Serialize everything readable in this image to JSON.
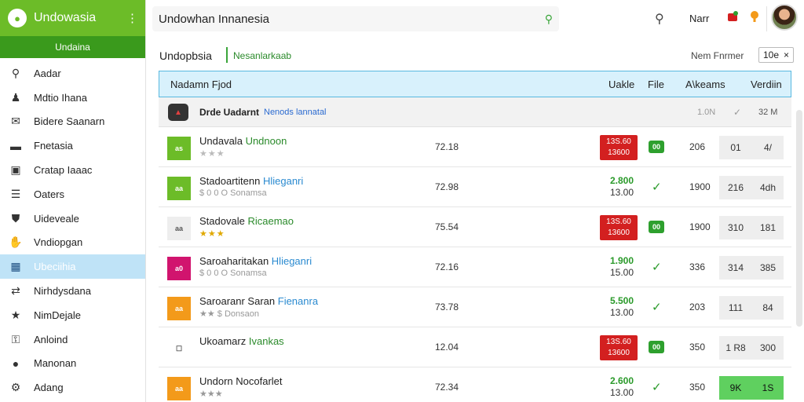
{
  "sidebar": {
    "brand_name": "Undowasia",
    "sub_brand": "Undaina",
    "items": [
      {
        "label": "Aadar",
        "icon": "search-icon"
      },
      {
        "label": "Mdtio Ihana",
        "icon": "person-icon"
      },
      {
        "label": "Bidere Saanarn",
        "icon": "inbox-icon"
      },
      {
        "label": "Fnetasia",
        "icon": "card-icon"
      },
      {
        "label": "Cratap Iaaac",
        "icon": "window-icon"
      },
      {
        "label": "Oaters",
        "icon": "list-icon"
      },
      {
        "label": "Uideveale",
        "icon": "shield-icon"
      },
      {
        "label": "Vndiopgan",
        "icon": "hand-icon"
      },
      {
        "label": "Ubeciihia",
        "icon": "grid-icon",
        "active": true
      },
      {
        "label": "Nirhdysdana",
        "icon": "arrows-icon"
      },
      {
        "label": "NimDejale",
        "icon": "star-icon"
      },
      {
        "label": "Anloind",
        "icon": "lock-icon"
      },
      {
        "label": "Manonan",
        "icon": "circle-icon"
      },
      {
        "label": "Adang",
        "icon": "gear-icon"
      }
    ]
  },
  "topbar": {
    "search_value": "Undowhan Innanesia",
    "user_name": "Narr"
  },
  "content": {
    "title": "Undopbsia",
    "subtitle": "Nesanlarkaab",
    "filter_label": "Nem Fnrmer",
    "close_label": "10e",
    "close_icon": "×"
  },
  "table": {
    "headers": {
      "name": "Nadamn Fjod",
      "uakle": "Uakle",
      "file": "File",
      "atkeams": "A\\keams",
      "verdiin": "Verdiin"
    },
    "subheader": {
      "name": "Drde Uadarnt",
      "tag": "Nenods lannatal",
      "v1": "1.0N",
      "v2": "✓",
      "v3": "32 M"
    },
    "rows": [
      {
        "thumb": "as",
        "thumb_color": "#6cbc28",
        "name": "Undavala",
        "tag": "Undnoon",
        "tag_type": "green",
        "sub": "",
        "stars": "★★★",
        "stars_gold": false,
        "num": "72.18",
        "status": "badge",
        "badge": [
          "13S.60",
          "13600"
        ],
        "indicator": "pill",
        "vol": "206",
        "c1": "01",
        "c2": "4/"
      },
      {
        "thumb": "aa",
        "thumb_color": "#6cbc28",
        "name": "Stadoartitenn",
        "tag": "Hlieganri",
        "tag_type": "blue",
        "sub": "$ 0 0 O Sonamsa",
        "stars": "",
        "stars_gold": false,
        "num": "72.98",
        "status": "price",
        "price": [
          "2.800",
          "13.00"
        ],
        "indicator": "check",
        "vol": "1900",
        "c1": "216",
        "c2": "4dh"
      },
      {
        "thumb": "aa",
        "thumb_color": "#eeeeee",
        "name": "Stadovale",
        "tag": "Ricaemao",
        "tag_type": "green",
        "sub": "",
        "stars": "★★★",
        "stars_gold": true,
        "num": "75.54",
        "status": "badge",
        "badge": [
          "13S.60",
          "13600"
        ],
        "indicator": "pill",
        "vol": "1900",
        "c1": "310",
        "c2": "181"
      },
      {
        "thumb": "a0",
        "thumb_color": "#d1146e",
        "name": "Saroaharitakan",
        "tag": "Hlieganri",
        "tag_type": "blue",
        "sub": "$ 0 0 O Sonamsa",
        "stars": "",
        "stars_gold": false,
        "num": "72.16",
        "status": "price",
        "price": [
          "1.900",
          "15.00"
        ],
        "indicator": "check",
        "vol": "336",
        "c1": "314",
        "c2": "385"
      },
      {
        "thumb": "aa",
        "thumb_color": "#f39a1a",
        "name": "Saroaranr Saran",
        "tag": "Fienanra",
        "tag_type": "blue",
        "sub": "★★ $ Donsaon",
        "stars": "",
        "stars_gold": false,
        "num": "73.78",
        "status": "price",
        "price": [
          "5.500",
          "13.00"
        ],
        "indicator": "check",
        "vol": "203",
        "c1": "111",
        "c2": "84"
      },
      {
        "thumb": "☐",
        "thumb_color": "#ffffff",
        "name": "Ukoamarz",
        "tag": "Ivankas",
        "tag_type": "green",
        "sub": "",
        "stars": "",
        "stars_gold": false,
        "num": "12.04",
        "status": "badge",
        "badge": [
          "13S.60",
          "13600"
        ],
        "indicator": "pill",
        "vol": "350",
        "c1": "1 R8",
        "c2": "300"
      },
      {
        "thumb": "aa",
        "thumb_color": "#f39a1a",
        "name": "Undorn Nocofarlet",
        "tag": "",
        "tag_type": "blue",
        "sub": "★★★",
        "stars": "",
        "stars_gold": false,
        "num": "72.34",
        "status": "price",
        "price": [
          "2.600",
          "13.00"
        ],
        "indicator": "check",
        "vol": "350",
        "c1": "9K",
        "c2": "1S",
        "c_green": true
      }
    ]
  },
  "pill_label": "00"
}
